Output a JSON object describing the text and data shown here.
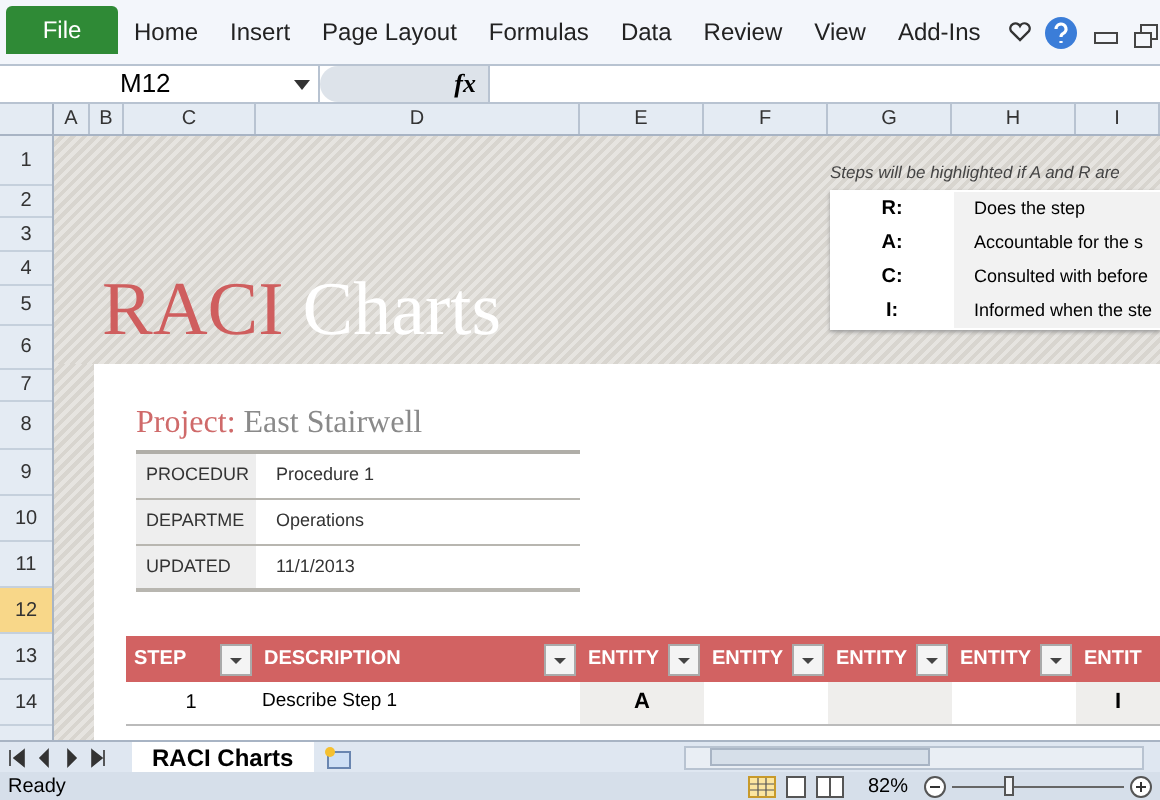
{
  "ribbon": {
    "file_tab": "File",
    "tabs": [
      "Home",
      "Insert",
      "Page Layout",
      "Formulas",
      "Data",
      "Review",
      "View",
      "Add-Ins"
    ]
  },
  "formula_bar": {
    "name_box": "M12",
    "fx": "fx"
  },
  "columns": [
    "A",
    "B",
    "C",
    "D",
    "E",
    "F",
    "G",
    "H",
    "I"
  ],
  "rows": [
    {
      "label": "1",
      "selected": false
    },
    {
      "label": "2",
      "selected": false
    },
    {
      "label": "3",
      "selected": false
    },
    {
      "label": "4",
      "selected": false
    },
    {
      "label": "5",
      "selected": false
    },
    {
      "label": "6",
      "selected": false
    },
    {
      "label": "7",
      "selected": false
    },
    {
      "label": "8",
      "selected": false
    },
    {
      "label": "9",
      "selected": false
    },
    {
      "label": "10",
      "selected": false
    },
    {
      "label": "11",
      "selected": false
    },
    {
      "label": "12",
      "selected": true
    },
    {
      "label": "13",
      "selected": false
    },
    {
      "label": "14",
      "selected": false
    }
  ],
  "title": {
    "first": "RACI",
    "second": "Charts"
  },
  "legend": {
    "note": "Steps will be highlighted if A and R are",
    "entries": [
      {
        "key": "R:",
        "text": "Does the step"
      },
      {
        "key": "A:",
        "text": "Accountable for the s"
      },
      {
        "key": "C:",
        "text": "Consulted with before"
      },
      {
        "key": "I:",
        "text": "Informed when the ste"
      }
    ]
  },
  "project": {
    "label": "Project:",
    "value": "East Stairwell"
  },
  "info": [
    {
      "label": "PROCEDUR",
      "value": "Procedure 1"
    },
    {
      "label": "DEPARTME",
      "value": "Operations"
    },
    {
      "label": "UPDATED",
      "value": "11/1/2013"
    }
  ],
  "table": {
    "columns": [
      "STEP",
      "DESCRIPTION",
      "ENTITY",
      "ENTITY",
      "ENTITY",
      "ENTITY",
      "ENTIT"
    ],
    "rows": [
      {
        "step": "1",
        "description": "Describe Step 1",
        "entity_1": "A",
        "entity_5": "I"
      }
    ]
  },
  "sheet_tabs": [
    {
      "label": "RACI Charts",
      "selected": true
    }
  ],
  "status": {
    "text": "Ready",
    "zoom": "82%",
    "level": 0.3
  }
}
